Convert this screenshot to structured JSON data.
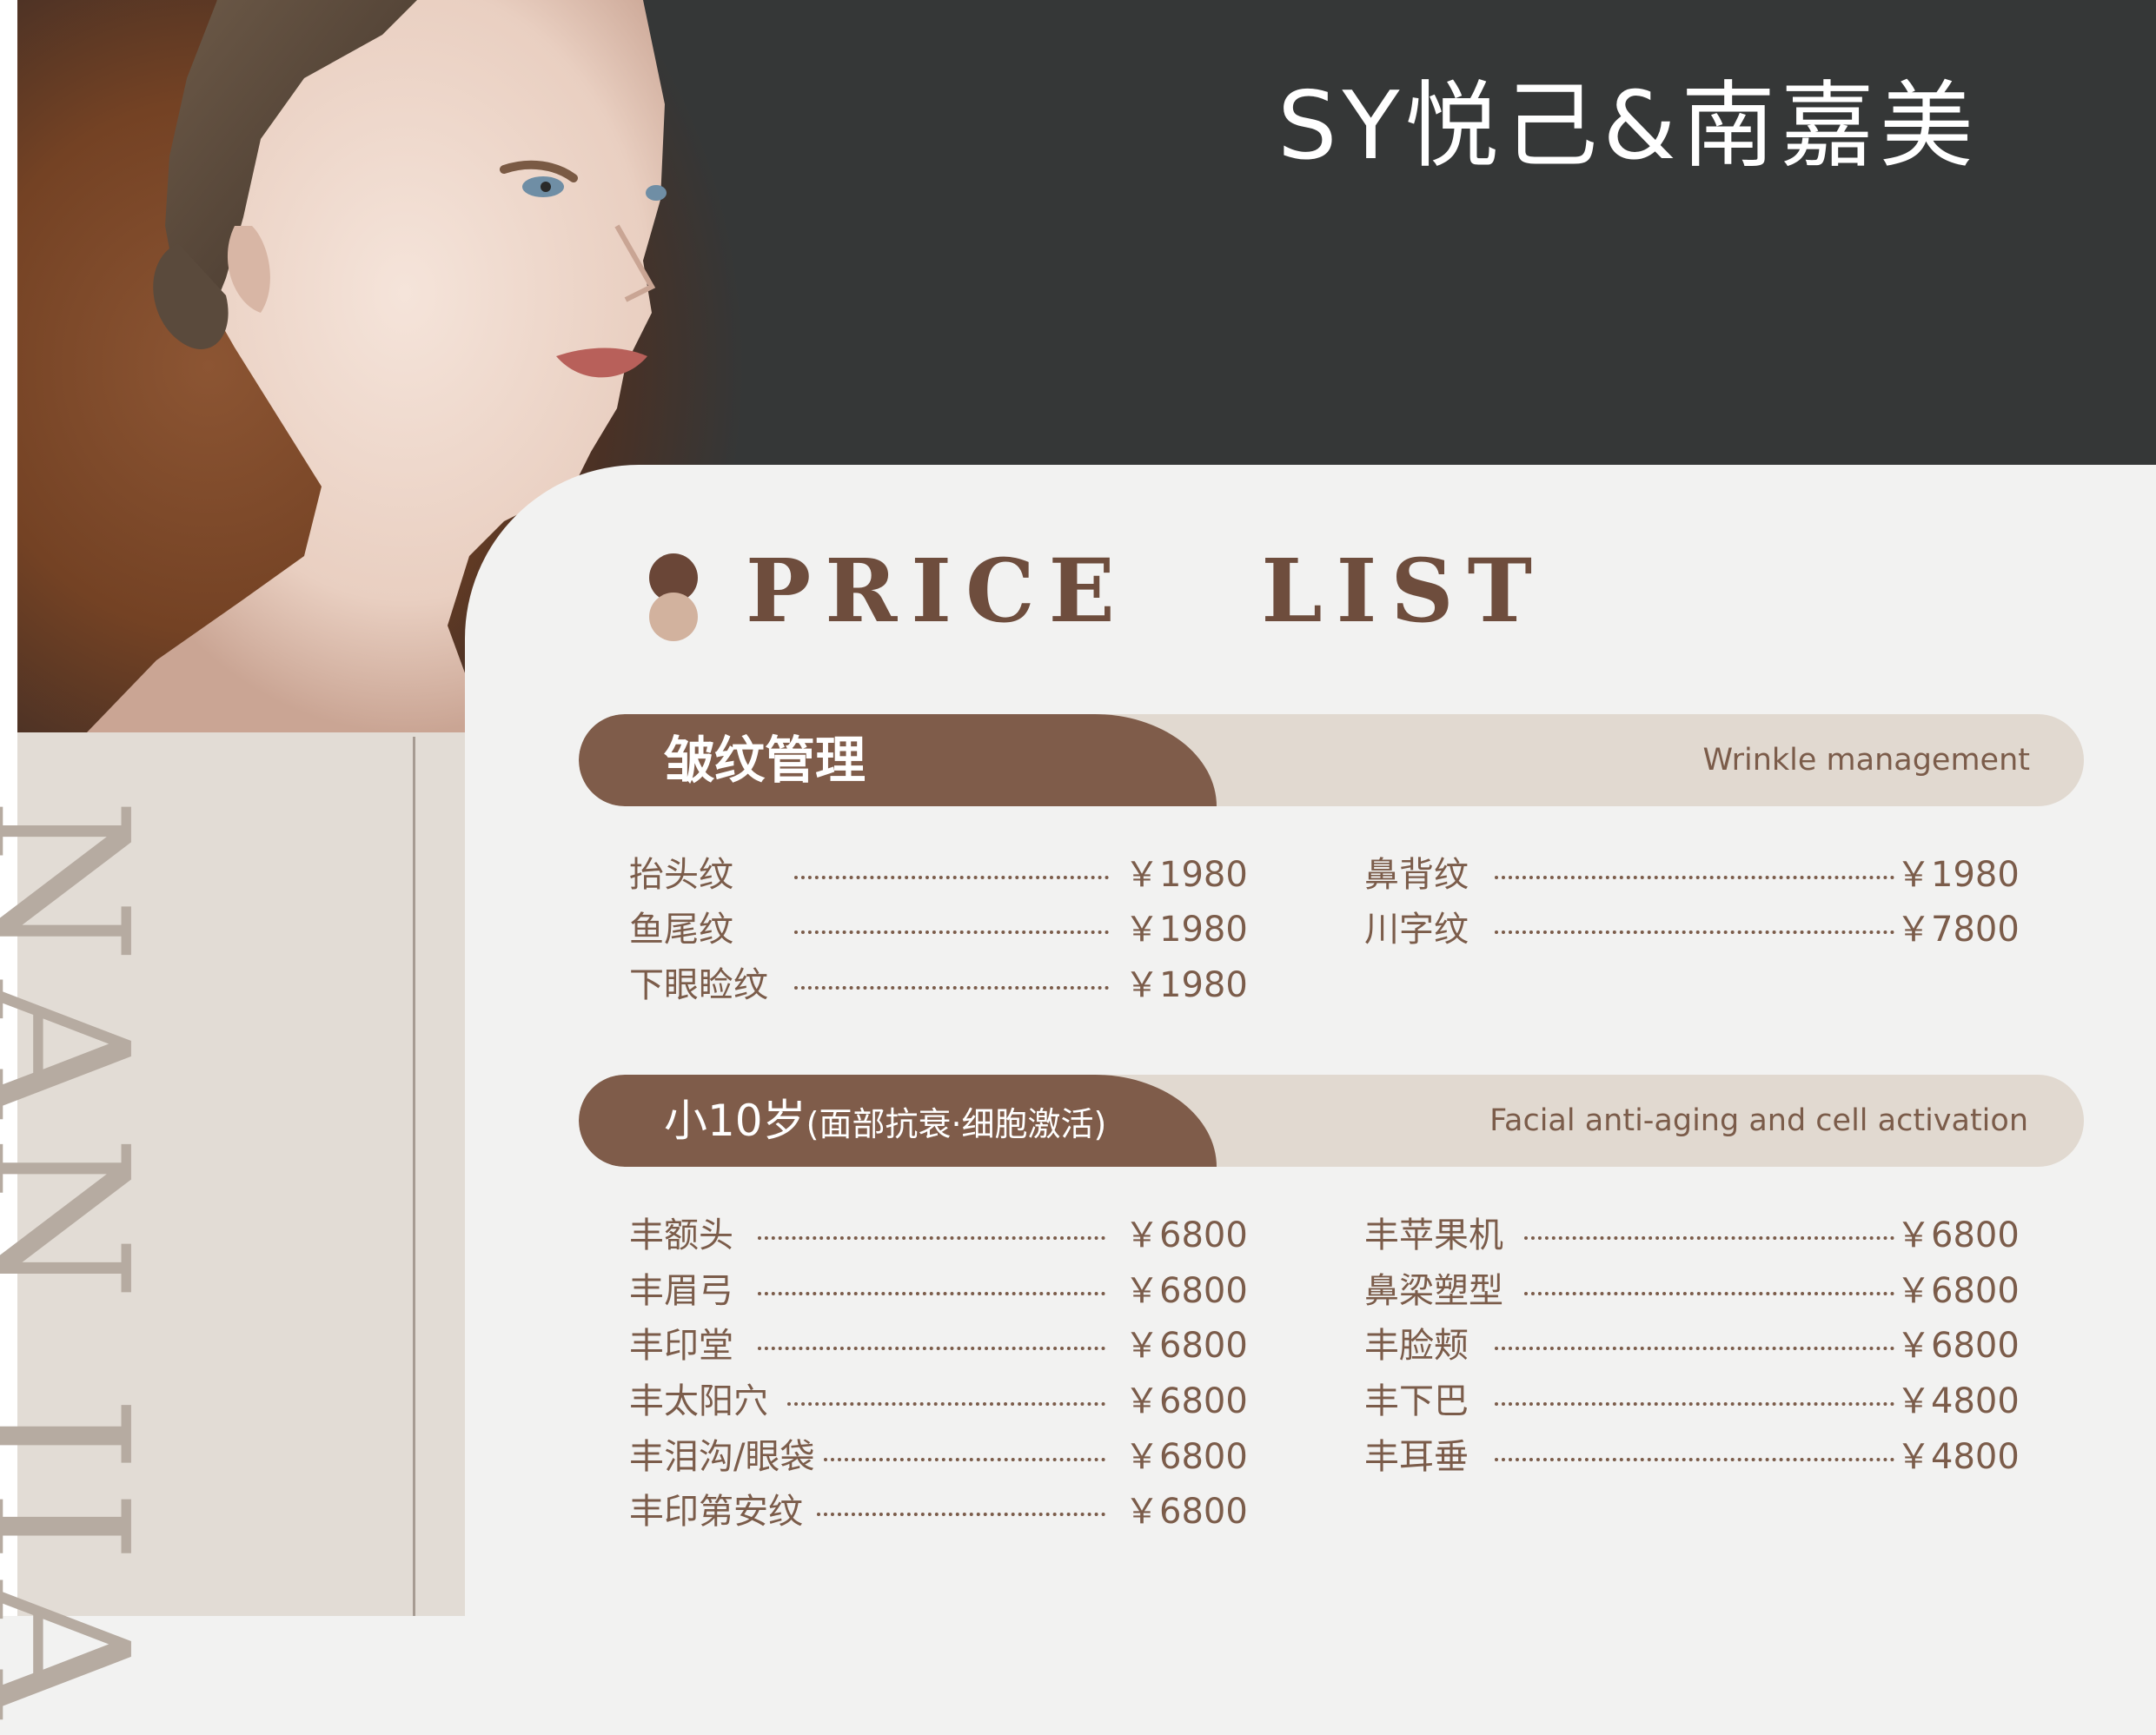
{
  "brand": "SY悦己&南嘉美",
  "vertical_text": "NAN JIA",
  "price_list_title": "PRICE   LIST",
  "sections": [
    {
      "title_cn": "皱纹管理",
      "title_en": "Wrinkle management",
      "left_items": [
        {
          "name": "抬头纹",
          "price": "￥1980"
        },
        {
          "name": "鱼尾纹",
          "price": "￥1980"
        },
        {
          "name": "下眼睑纹",
          "price": "￥1980"
        }
      ],
      "right_items": [
        {
          "name": "鼻背纹",
          "price": "￥1980"
        },
        {
          "name": "川字纹",
          "price": "￥7800"
        }
      ]
    },
    {
      "title_cn_main": "小10岁",
      "title_cn_sub": "(面部抗衰·细胞激活)",
      "title_en": "Facial anti-aging and cell activation",
      "left_items": [
        {
          "name": "丰额头",
          "price": "￥6800"
        },
        {
          "name": "丰眉弓",
          "price": "￥6800"
        },
        {
          "name": "丰印堂",
          "price": "￥6800"
        },
        {
          "name": "丰太阳穴",
          "price": "￥6800"
        },
        {
          "name": "丰泪沟/眼袋",
          "price": "￥6800"
        },
        {
          "name": "丰印第安纹",
          "price": "￥6800"
        }
      ],
      "right_items": [
        {
          "name": "丰苹果机",
          "price": "￥6800"
        },
        {
          "name": "鼻梁塑型",
          "price": "￥6800"
        },
        {
          "name": "丰脸颊",
          "price": "￥6800"
        },
        {
          "name": "丰下巴",
          "price": "￥4800"
        },
        {
          "name": "丰耳垂",
          "price": "￥4800"
        }
      ]
    }
  ],
  "colors": {
    "dark_header": "#353737",
    "accent_brown": "#7f5c4a",
    "band_light": "#e1d9d0",
    "text_brown": "#7b5c4a"
  }
}
